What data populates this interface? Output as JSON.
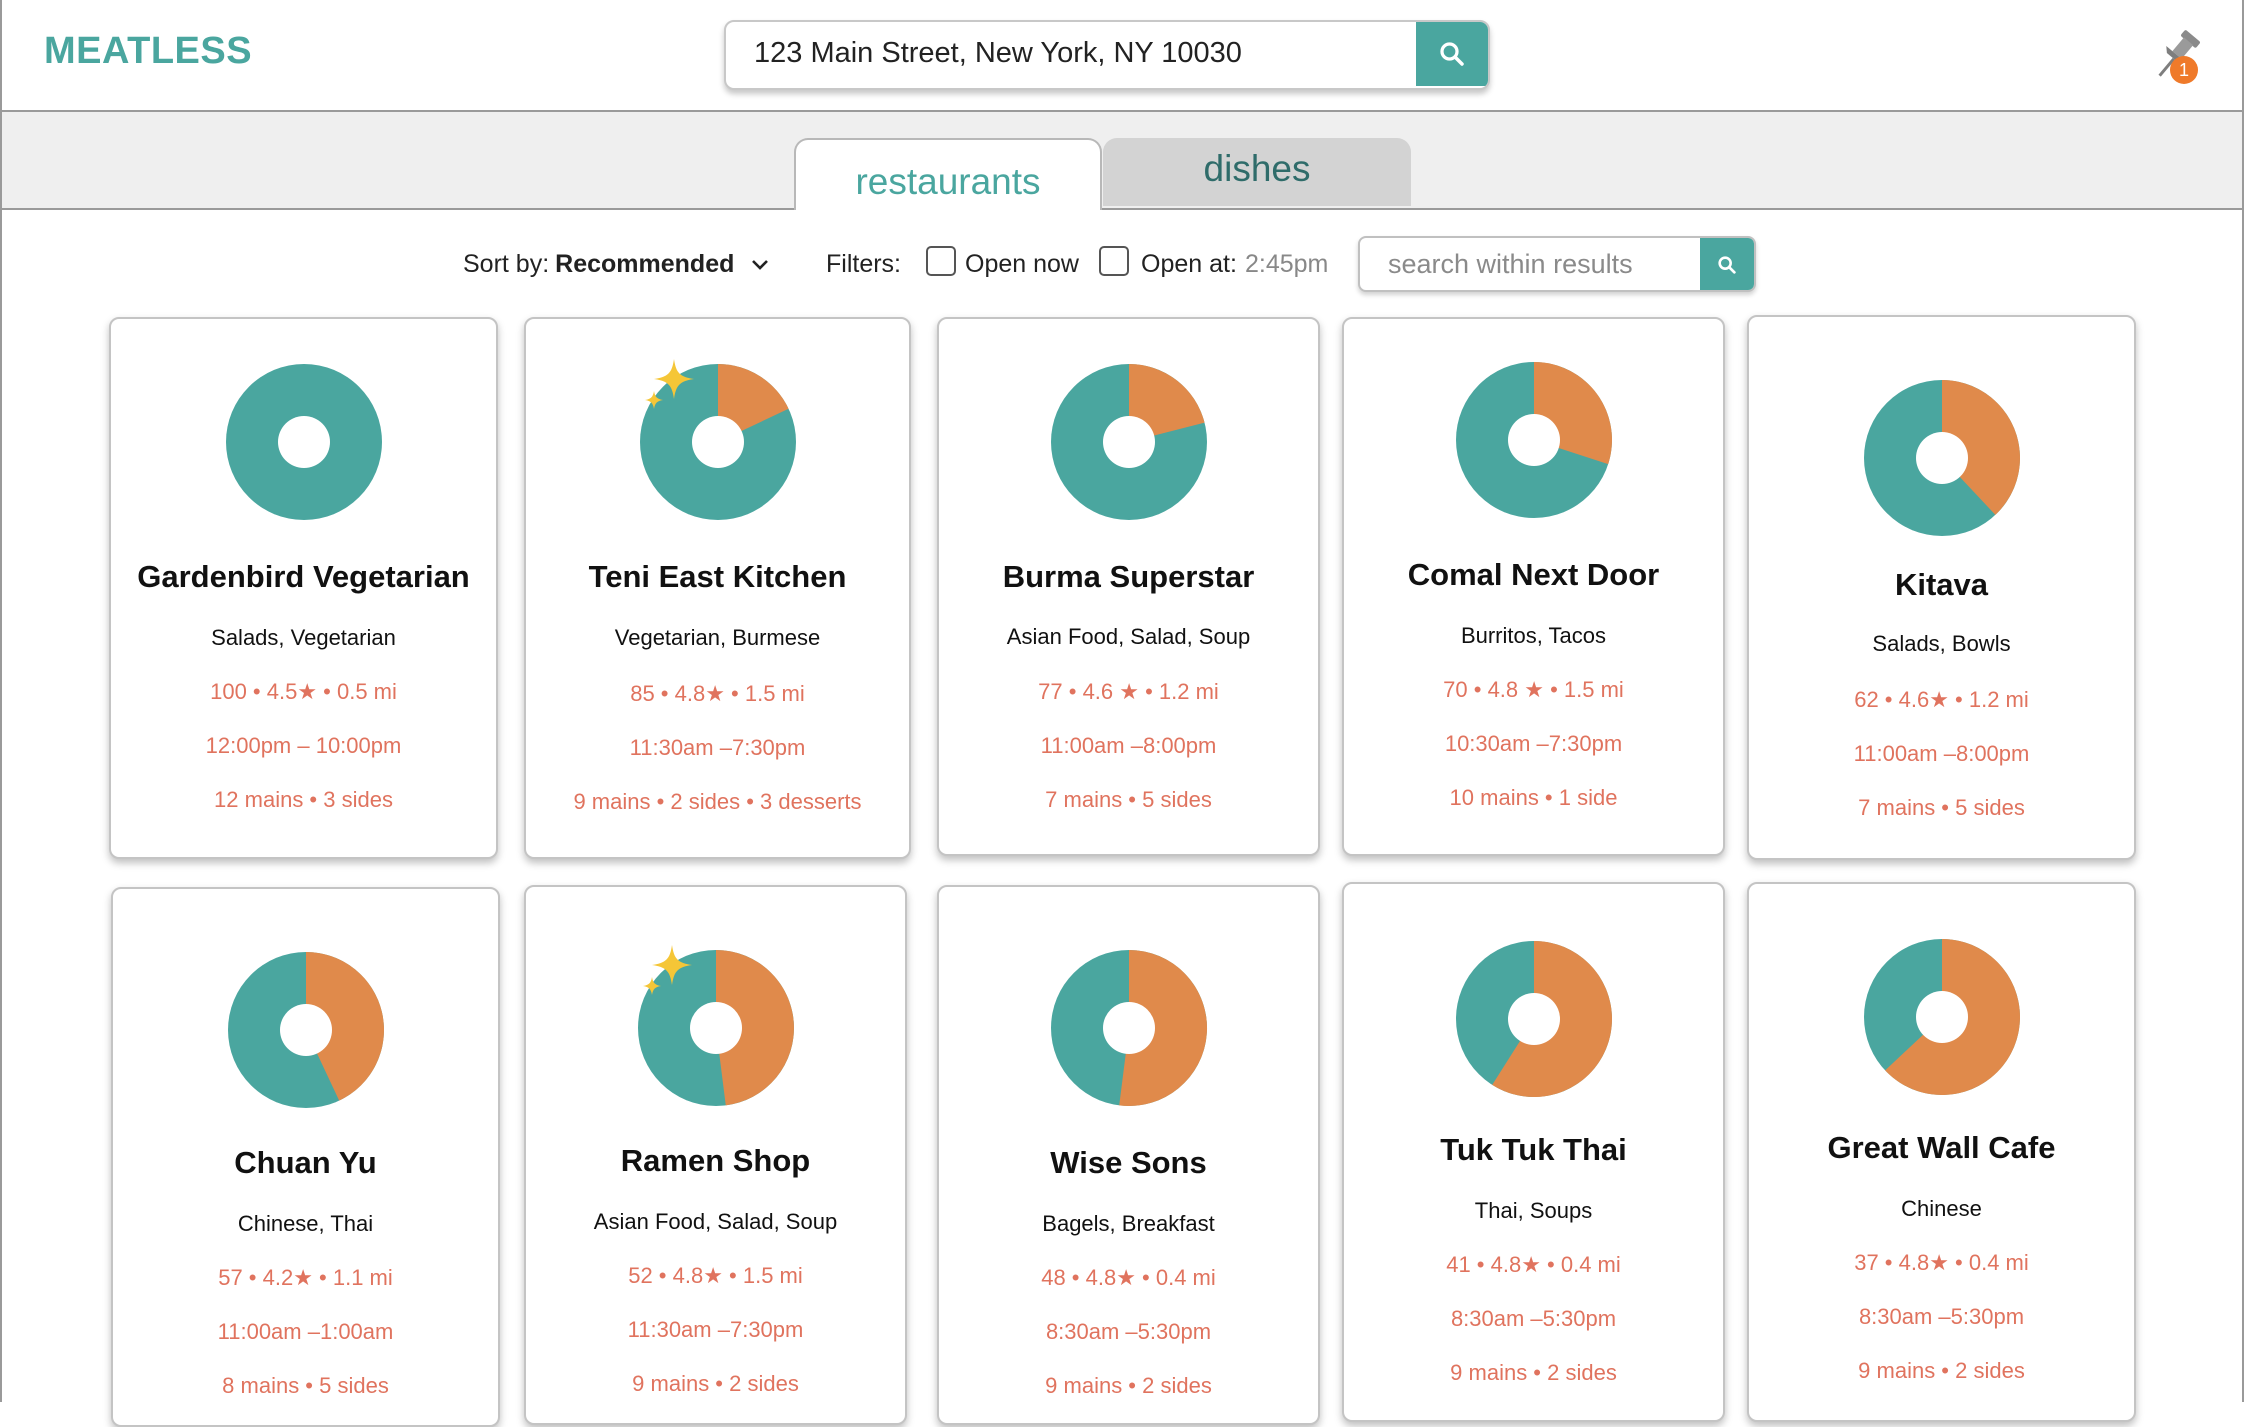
{
  "app": {
    "logo": "MEATLESS"
  },
  "search": {
    "address": "123 Main Street, New York, NY 10030"
  },
  "pinned": {
    "count": "1"
  },
  "tabs": [
    {
      "label": "restaurants",
      "active": true
    },
    {
      "label": "dishes",
      "active": false
    }
  ],
  "controls": {
    "sort_label": "Sort by:",
    "sort_value": "Recommended",
    "filters_label": "Filters:",
    "open_now_label": "Open now",
    "open_at_label": "Open at:",
    "open_at_time": "2:45pm",
    "results_placeholder": "search within results"
  },
  "colors": {
    "teal": "#4aa69f",
    "orange": "#e08a4b",
    "info": "#e0735e",
    "badge": "#ef7a2a",
    "sparkle": "#f5c637"
  },
  "restaurants": [
    {
      "name": "Gardenbird Vegetarian",
      "categories": "Salads, Vegetarian",
      "stats": "100 • 4.5★ • 0.5 mi",
      "hours": "12:00pm – 10:00pm",
      "menu": "12 mains • 3 sides",
      "veg_fraction": 1.0,
      "featured": false
    },
    {
      "name": "Teni East Kitchen",
      "categories": "Vegetarian, Burmese",
      "stats": "85 • 4.8★ • 1.5 mi",
      "hours": "11:30am –7:30pm",
      "menu": "9 mains • 2 sides • 3 desserts",
      "veg_fraction": 0.82,
      "featured": true
    },
    {
      "name": "Burma Superstar",
      "categories": "Asian Food, Salad, Soup",
      "stats": "77 • 4.6 ★ • 1.2 mi",
      "hours": "11:00am –8:00pm",
      "menu": "7 mains • 5 sides",
      "veg_fraction": 0.79,
      "featured": false
    },
    {
      "name": "Comal Next Door",
      "categories": "Burritos, Tacos",
      "stats": "70 • 4.8 ★ • 1.5 mi",
      "hours": "10:30am –7:30pm",
      "menu": "10 mains • 1 side",
      "veg_fraction": 0.7,
      "featured": false
    },
    {
      "name": "Kitava",
      "categories": "Salads, Bowls",
      "stats": "62 • 4.6★ • 1.2 mi",
      "hours": "11:00am –8:00pm",
      "menu": "7 mains • 5 sides",
      "veg_fraction": 0.62,
      "featured": false
    },
    {
      "name": "Chuan Yu",
      "categories": "Chinese, Thai",
      "stats": "57 • 4.2★ • 1.1 mi",
      "hours": "11:00am –1:00am",
      "menu": "8 mains • 5 sides",
      "veg_fraction": 0.57,
      "featured": false
    },
    {
      "name": "Ramen Shop",
      "categories": "Asian Food, Salad, Soup",
      "stats": "52 • 4.8★ • 1.5 mi",
      "hours": "11:30am –7:30pm",
      "menu": "9 mains • 2 sides",
      "veg_fraction": 0.52,
      "featured": true
    },
    {
      "name": "Wise Sons",
      "categories": "Bagels, Breakfast",
      "stats": "48 • 4.8★ • 0.4 mi",
      "hours": "8:30am –5:30pm",
      "menu": "9 mains • 2 sides",
      "veg_fraction": 0.48,
      "featured": false
    },
    {
      "name": "Tuk Tuk Thai",
      "categories": "Thai, Soups",
      "stats": "41 • 4.8★ • 0.4 mi",
      "hours": "8:30am –5:30pm",
      "menu": "9 mains • 2 sides",
      "veg_fraction": 0.41,
      "featured": false
    },
    {
      "name": "Great Wall Cafe",
      "categories": "Chinese",
      "stats": "37 • 4.8★ • 0.4 mi",
      "hours": "8:30am –5:30pm",
      "menu": "9 mains • 2 sides",
      "veg_fraction": 0.37,
      "featured": false
    }
  ]
}
